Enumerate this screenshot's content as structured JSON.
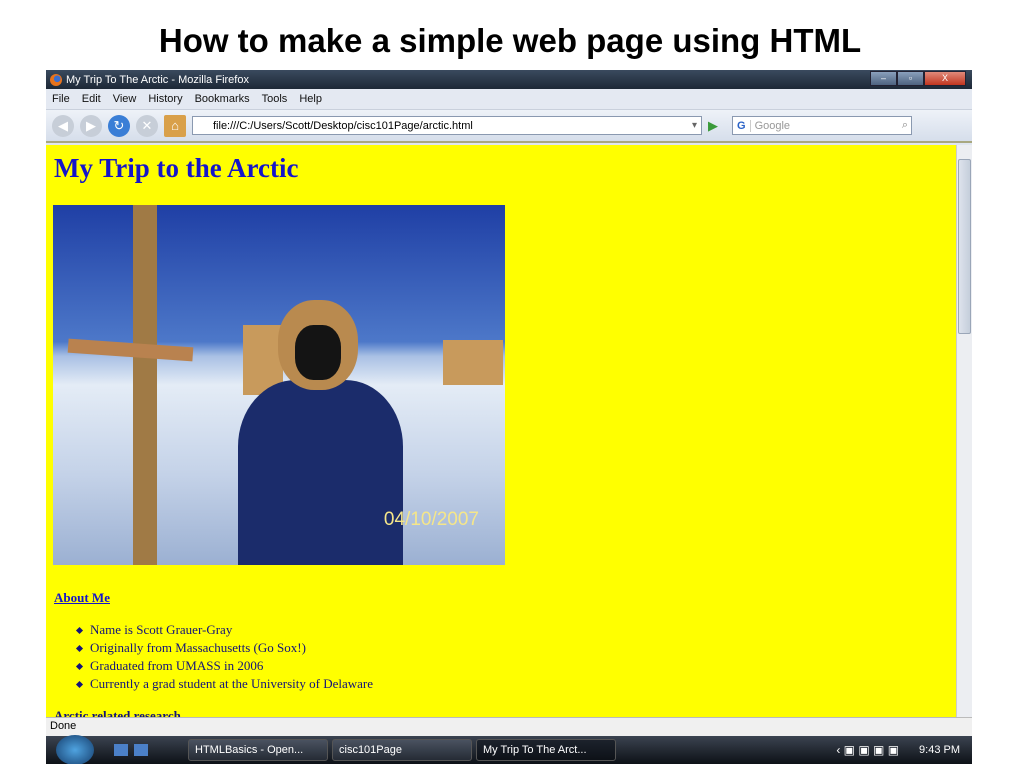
{
  "slide": {
    "title": "How to make a simple web page using HTML"
  },
  "window": {
    "title": "My Trip To The Arctic - Mozilla Firefox",
    "controls": [
      "–",
      "▫",
      "X"
    ]
  },
  "menu": [
    "File",
    "Edit",
    "View",
    "History",
    "Bookmarks",
    "Tools",
    "Help"
  ],
  "toolbar": {
    "url": "file:///C:/Users/Scott/Desktop/cisc101Page/arctic.html",
    "search_engine": "G",
    "search_placeholder": "Google"
  },
  "page": {
    "heading": "My Trip to the Arctic",
    "photo_date": "04/10/2007",
    "about_link": "About Me",
    "about_items": [
      "Name is Scott Grauer-Gray",
      "Originally from Massachusetts (Go Sox!)",
      "Graduated from UMASS in 2006",
      "Currently a grad student at the University of Delaware"
    ],
    "next_heading": "Arctic related research",
    "background_color": "#ffff00",
    "link_color": "#1515c9"
  },
  "status": "Done",
  "taskbar": {
    "items": [
      "HTMLBasics - Open...",
      "cisc101Page",
      "My Trip To The Arct..."
    ],
    "clock": "9:43 PM"
  }
}
